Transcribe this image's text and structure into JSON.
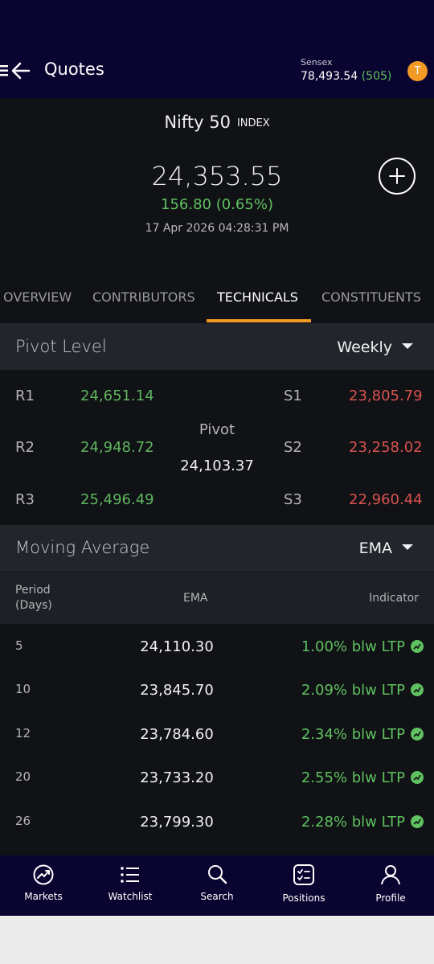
{
  "header": {
    "title": "Quotes",
    "sensex_label": "Sensex",
    "sensex_value": "78,493.54",
    "sensex_change": "(505)",
    "avatar_letter": "T"
  },
  "quote": {
    "name": "Nifty 50",
    "tag": "INDEX",
    "price": "24,353.55",
    "change": "156.80 (0.65%)",
    "timestamp": "17 Apr 2026 04:28:31 PM"
  },
  "tabs": [
    {
      "label": "OVERVIEW",
      "active": false
    },
    {
      "label": "CONTRIBUTORS",
      "active": false
    },
    {
      "label": "TECHNICALS",
      "active": true
    },
    {
      "label": "CONSTITUENTS",
      "active": false
    }
  ],
  "pivot": {
    "title": "Pivot Level",
    "period": "Weekly",
    "pivot_label": "Pivot",
    "pivot_value": "24,103.37",
    "resistance": [
      {
        "label": "R1",
        "value": "24,651.14"
      },
      {
        "label": "R2",
        "value": "24,948.72"
      },
      {
        "label": "R3",
        "value": "25,496.49"
      }
    ],
    "support": [
      {
        "label": "S1",
        "value": "23,805.79"
      },
      {
        "label": "S2",
        "value": "23,258.02"
      },
      {
        "label": "S3",
        "value": "22,960.44"
      }
    ]
  },
  "moving_average": {
    "title": "Moving Average",
    "type": "EMA",
    "col_period_1": "Period",
    "col_period_2": "(Days)",
    "col_ema": "EMA",
    "col_indicator": "Indicator",
    "rows": [
      {
        "period": "5",
        "ema": "24,110.30",
        "indicator": "1.00% blw LTP"
      },
      {
        "period": "10",
        "ema": "23,845.70",
        "indicator": "2.09% blw LTP"
      },
      {
        "period": "12",
        "ema": "23,784.60",
        "indicator": "2.34% blw LTP"
      },
      {
        "period": "20",
        "ema": "23,733.20",
        "indicator": "2.55% blw LTP"
      },
      {
        "period": "26",
        "ema": "23,799.30",
        "indicator": "2.28% blw LTP"
      }
    ]
  },
  "nav": [
    {
      "label": "Markets",
      "icon": "markets-icon"
    },
    {
      "label": "Watchlist",
      "icon": "watchlist-icon"
    },
    {
      "label": "Search",
      "icon": "search-icon"
    },
    {
      "label": "Positions",
      "icon": "positions-icon"
    },
    {
      "label": "Profile",
      "icon": "profile-icon"
    }
  ],
  "colors": {
    "header_bg": "#0a0430",
    "positive": "#5fc15f",
    "negative": "#d9534f",
    "accent": "#f39a26"
  }
}
